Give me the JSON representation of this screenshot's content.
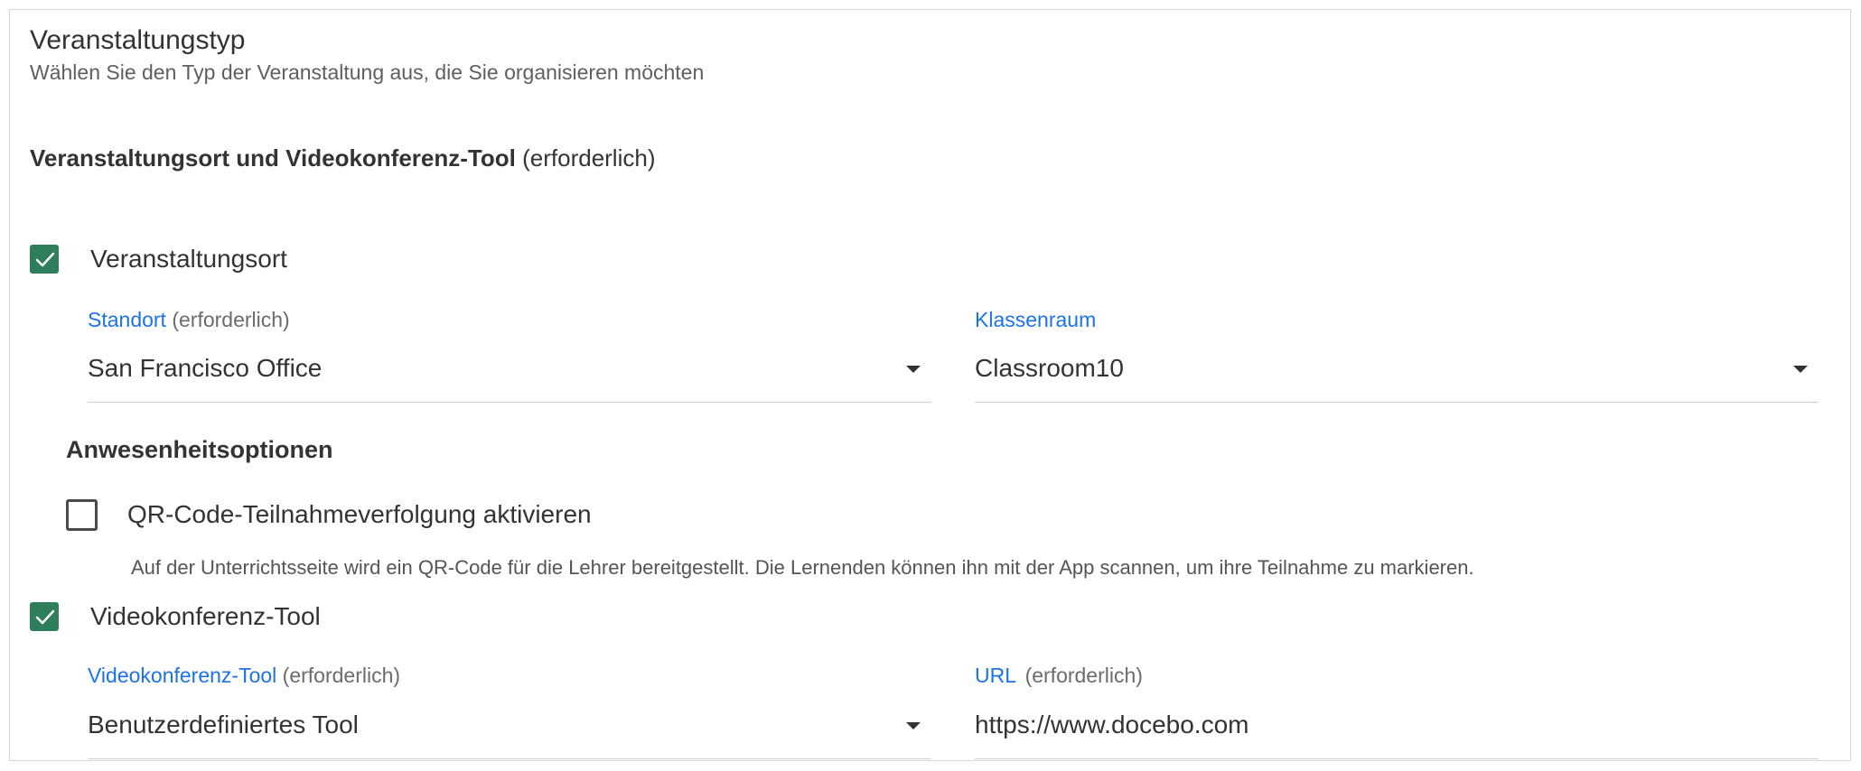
{
  "header": {
    "title": "Veranstaltungstyp",
    "subtitle": "Wählen Sie den Typ der Veranstaltung aus, die Sie organisieren möchten"
  },
  "location_section": {
    "heading": "Veranstaltungsort und Videokonferenz-Tool",
    "required": "(erforderlich)"
  },
  "venue": {
    "checkbox_label": "Veranstaltungsort",
    "checked": true,
    "location": {
      "label": "Standort",
      "required": "(erforderlich)",
      "value": "San Francisco Office"
    },
    "classroom": {
      "label": "Klassenraum",
      "value": "Classroom10"
    }
  },
  "attendance": {
    "heading": "Anwesenheitsoptionen",
    "qr_label": "QR-Code-Teilnahmeverfolgung aktivieren",
    "qr_checked": false,
    "qr_help": "Auf der Unterrichtsseite wird ein QR-Code für die Lehrer bereitgestellt. Die Lernenden können ihn mit der App scannen, um ihre Teilnahme zu markieren."
  },
  "video": {
    "checkbox_label": "Videokonferenz-Tool",
    "checked": true,
    "tool": {
      "label": "Videokonferenz-Tool",
      "required": "(erforderlich)",
      "value": "Benutzerdefiniertes Tool"
    },
    "url": {
      "label": "URL",
      "required": "(erforderlich)",
      "value": "https://www.docebo.com"
    }
  },
  "colors": {
    "accent_label": "#1a73e8",
    "checkbox_checked": "#2e7d5b"
  },
  "icons": [
    "check-icon",
    "dropdown-caret-icon"
  ]
}
